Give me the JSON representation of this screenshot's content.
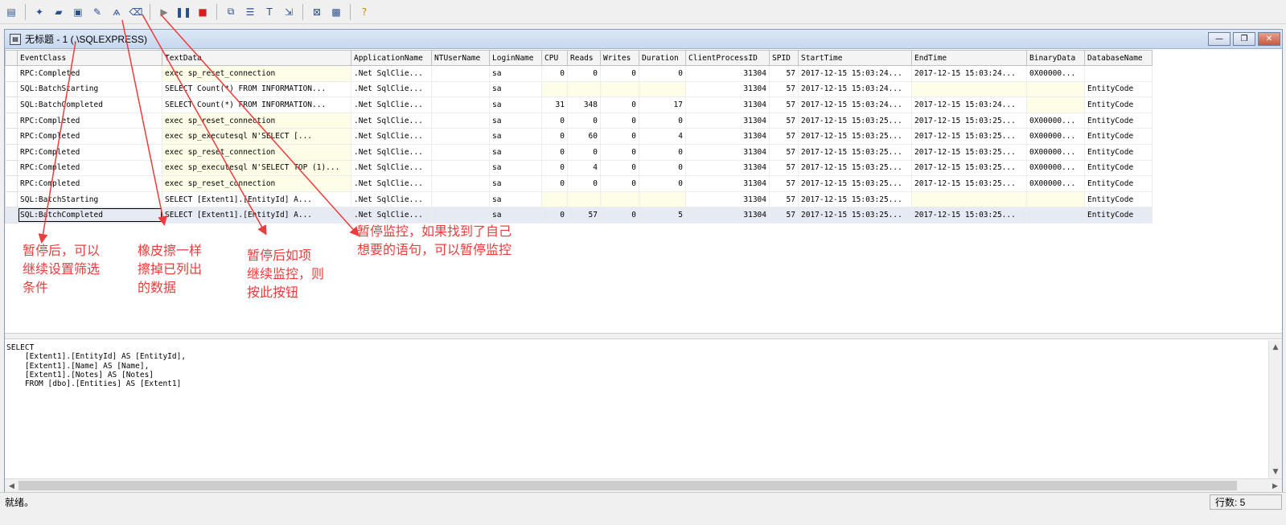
{
  "toolbar": {
    "buttons": [
      {
        "icon": "properties-icon",
        "glyph": "▤"
      },
      {
        "icon": "new-trace-icon",
        "glyph": "✦"
      },
      {
        "icon": "open-icon",
        "glyph": "▰"
      },
      {
        "icon": "save-icon",
        "glyph": "▣"
      },
      {
        "icon": "template-icon",
        "glyph": "✎"
      },
      {
        "icon": "find-icon",
        "glyph": "ѧ"
      },
      {
        "icon": "eraser-icon",
        "glyph": "⌫"
      },
      {
        "icon": "run-icon",
        "glyph": "▶"
      },
      {
        "icon": "pause-icon",
        "glyph": "❚❚"
      },
      {
        "icon": "stop-icon",
        "glyph": "■"
      },
      {
        "icon": "filter-icon",
        "glyph": "⧉"
      },
      {
        "icon": "group-icon",
        "glyph": "☰"
      },
      {
        "icon": "column-icon",
        "glyph": "T"
      },
      {
        "icon": "auto-scroll-icon",
        "glyph": "⇲"
      },
      {
        "icon": "tuning-icon",
        "glyph": "⊠"
      },
      {
        "icon": "perfmon-icon",
        "glyph": "▩"
      },
      {
        "icon": "help-icon",
        "glyph": "?"
      }
    ]
  },
  "window": {
    "title": "无标题 - 1 (.\\SQLEXPRESS)",
    "controls": {
      "minimize": "—",
      "restore": "❐",
      "close": "✕"
    }
  },
  "grid": {
    "columns": [
      "EventClass",
      "TextData",
      "ApplicationName",
      "NTUserName",
      "LoginName",
      "CPU",
      "Reads",
      "Writes",
      "Duration",
      "ClientProcessID",
      "SPID",
      "StartTime",
      "EndTime",
      "BinaryData",
      "DatabaseName"
    ],
    "rows": [
      {
        "EventClass": "RPC:Completed",
        "TextData": "exec sp_reset_connection",
        "ApplicationName": ".Net SqlClie...",
        "NTUserName": "",
        "LoginName": "sa",
        "CPU": "0",
        "Reads": "0",
        "Writes": "0",
        "Duration": "0",
        "ClientProcessID": "31304",
        "SPID": "57",
        "StartTime": "2017-12-15 15:03:24...",
        "EndTime": "2017-12-15 15:03:24...",
        "BinaryData": "0X00000...",
        "DatabaseName": ""
      },
      {
        "EventClass": "SQL:BatchStarting",
        "TextData": "  SELECT Count(*)  FROM INFORMATION...",
        "ApplicationName": ".Net SqlClie...",
        "NTUserName": "",
        "LoginName": "sa",
        "CPU": "",
        "Reads": "",
        "Writes": "",
        "Duration": "",
        "ClientProcessID": "31304",
        "SPID": "57",
        "StartTime": "2017-12-15 15:03:24...",
        "EndTime": "",
        "BinaryData": "",
        "DatabaseName": "EntityCode"
      },
      {
        "EventClass": "SQL:BatchCompleted",
        "TextData": "  SELECT Count(*)  FROM INFORMATION...",
        "ApplicationName": ".Net SqlClie...",
        "NTUserName": "",
        "LoginName": "sa",
        "CPU": "31",
        "Reads": "348",
        "Writes": "0",
        "Duration": "17",
        "ClientProcessID": "31304",
        "SPID": "57",
        "StartTime": "2017-12-15 15:03:24...",
        "EndTime": "2017-12-15 15:03:24...",
        "BinaryData": "",
        "DatabaseName": "EntityCode"
      },
      {
        "EventClass": "RPC:Completed",
        "TextData": "exec sp_reset_connection",
        "ApplicationName": ".Net SqlClie...",
        "NTUserName": "",
        "LoginName": "sa",
        "CPU": "0",
        "Reads": "0",
        "Writes": "0",
        "Duration": "0",
        "ClientProcessID": "31304",
        "SPID": "57",
        "StartTime": "2017-12-15 15:03:25...",
        "EndTime": "2017-12-15 15:03:25...",
        "BinaryData": "0X00000...",
        "DatabaseName": "EntityCode"
      },
      {
        "EventClass": "RPC:Completed",
        "TextData": "exec sp_executesql N'SELECT       [...",
        "ApplicationName": ".Net SqlClie...",
        "NTUserName": "",
        "LoginName": "sa",
        "CPU": "0",
        "Reads": "60",
        "Writes": "0",
        "Duration": "4",
        "ClientProcessID": "31304",
        "SPID": "57",
        "StartTime": "2017-12-15 15:03:25...",
        "EndTime": "2017-12-15 15:03:25...",
        "BinaryData": "0X00000...",
        "DatabaseName": "EntityCode"
      },
      {
        "EventClass": "RPC:Completed",
        "TextData": "exec sp_reset_connection",
        "ApplicationName": ".Net SqlClie...",
        "NTUserName": "",
        "LoginName": "sa",
        "CPU": "0",
        "Reads": "0",
        "Writes": "0",
        "Duration": "0",
        "ClientProcessID": "31304",
        "SPID": "57",
        "StartTime": "2017-12-15 15:03:25...",
        "EndTime": "2017-12-15 15:03:25...",
        "BinaryData": "0X00000...",
        "DatabaseName": "EntityCode"
      },
      {
        "EventClass": "RPC:Completed",
        "TextData": "exec sp_executesql N'SELECT TOP (1)...",
        "ApplicationName": ".Net SqlClie...",
        "NTUserName": "",
        "LoginName": "sa",
        "CPU": "0",
        "Reads": "4",
        "Writes": "0",
        "Duration": "0",
        "ClientProcessID": "31304",
        "SPID": "57",
        "StartTime": "2017-12-15 15:03:25...",
        "EndTime": "2017-12-15 15:03:25...",
        "BinaryData": "0X00000...",
        "DatabaseName": "EntityCode"
      },
      {
        "EventClass": "RPC:Completed",
        "TextData": "exec sp_reset_connection",
        "ApplicationName": ".Net SqlClie...",
        "NTUserName": "",
        "LoginName": "sa",
        "CPU": "0",
        "Reads": "0",
        "Writes": "0",
        "Duration": "0",
        "ClientProcessID": "31304",
        "SPID": "57",
        "StartTime": "2017-12-15 15:03:25...",
        "EndTime": "2017-12-15 15:03:25...",
        "BinaryData": "0X00000...",
        "DatabaseName": "EntityCode"
      },
      {
        "EventClass": "SQL:BatchStarting",
        "TextData": "SELECT       [Extent1].[EntityId] A...",
        "ApplicationName": ".Net SqlClie...",
        "NTUserName": "",
        "LoginName": "sa",
        "CPU": "",
        "Reads": "",
        "Writes": "",
        "Duration": "",
        "ClientProcessID": "31304",
        "SPID": "57",
        "StartTime": "2017-12-15 15:03:25...",
        "EndTime": "",
        "BinaryData": "",
        "DatabaseName": "EntityCode"
      },
      {
        "EventClass": "SQL:BatchCompleted",
        "TextData": "SELECT       [Extent1].[EntityId] A...",
        "ApplicationName": ".Net SqlClie...",
        "NTUserName": "",
        "LoginName": "sa",
        "CPU": "0",
        "Reads": "57",
        "Writes": "0",
        "Duration": "5",
        "ClientProcessID": "31304",
        "SPID": "57",
        "StartTime": "2017-12-15 15:03:25...",
        "EndTime": "2017-12-15 15:03:25...",
        "BinaryData": "",
        "DatabaseName": "EntityCode"
      }
    ],
    "selected_row": 9
  },
  "text_pane": "SELECT \n    [Extent1].[EntityId] AS [EntityId], \n    [Extent1].[Name] AS [Name], \n    [Extent1].[Notes] AS [Notes]\n    FROM [dbo].[Entities] AS [Extent1]",
  "status": {
    "text": "就绪。",
    "rows": "行数: 5"
  },
  "annotations": {
    "note_filter": "暂停后，可以\n继续设置筛选\n条件",
    "note_eraser": "橡皮擦一样\n擦掉已列出\n的数据",
    "note_resume": "暂停后如项\n继续监控，则\n按此按钮",
    "note_pause": "暂停监控，如果找到了自己\n想要的语句，可以暂停监控"
  },
  "colors": {
    "annotation": "#ee3b3b",
    "highlight_cell": "#fefee8",
    "selected_row": "#e6ebf3"
  }
}
